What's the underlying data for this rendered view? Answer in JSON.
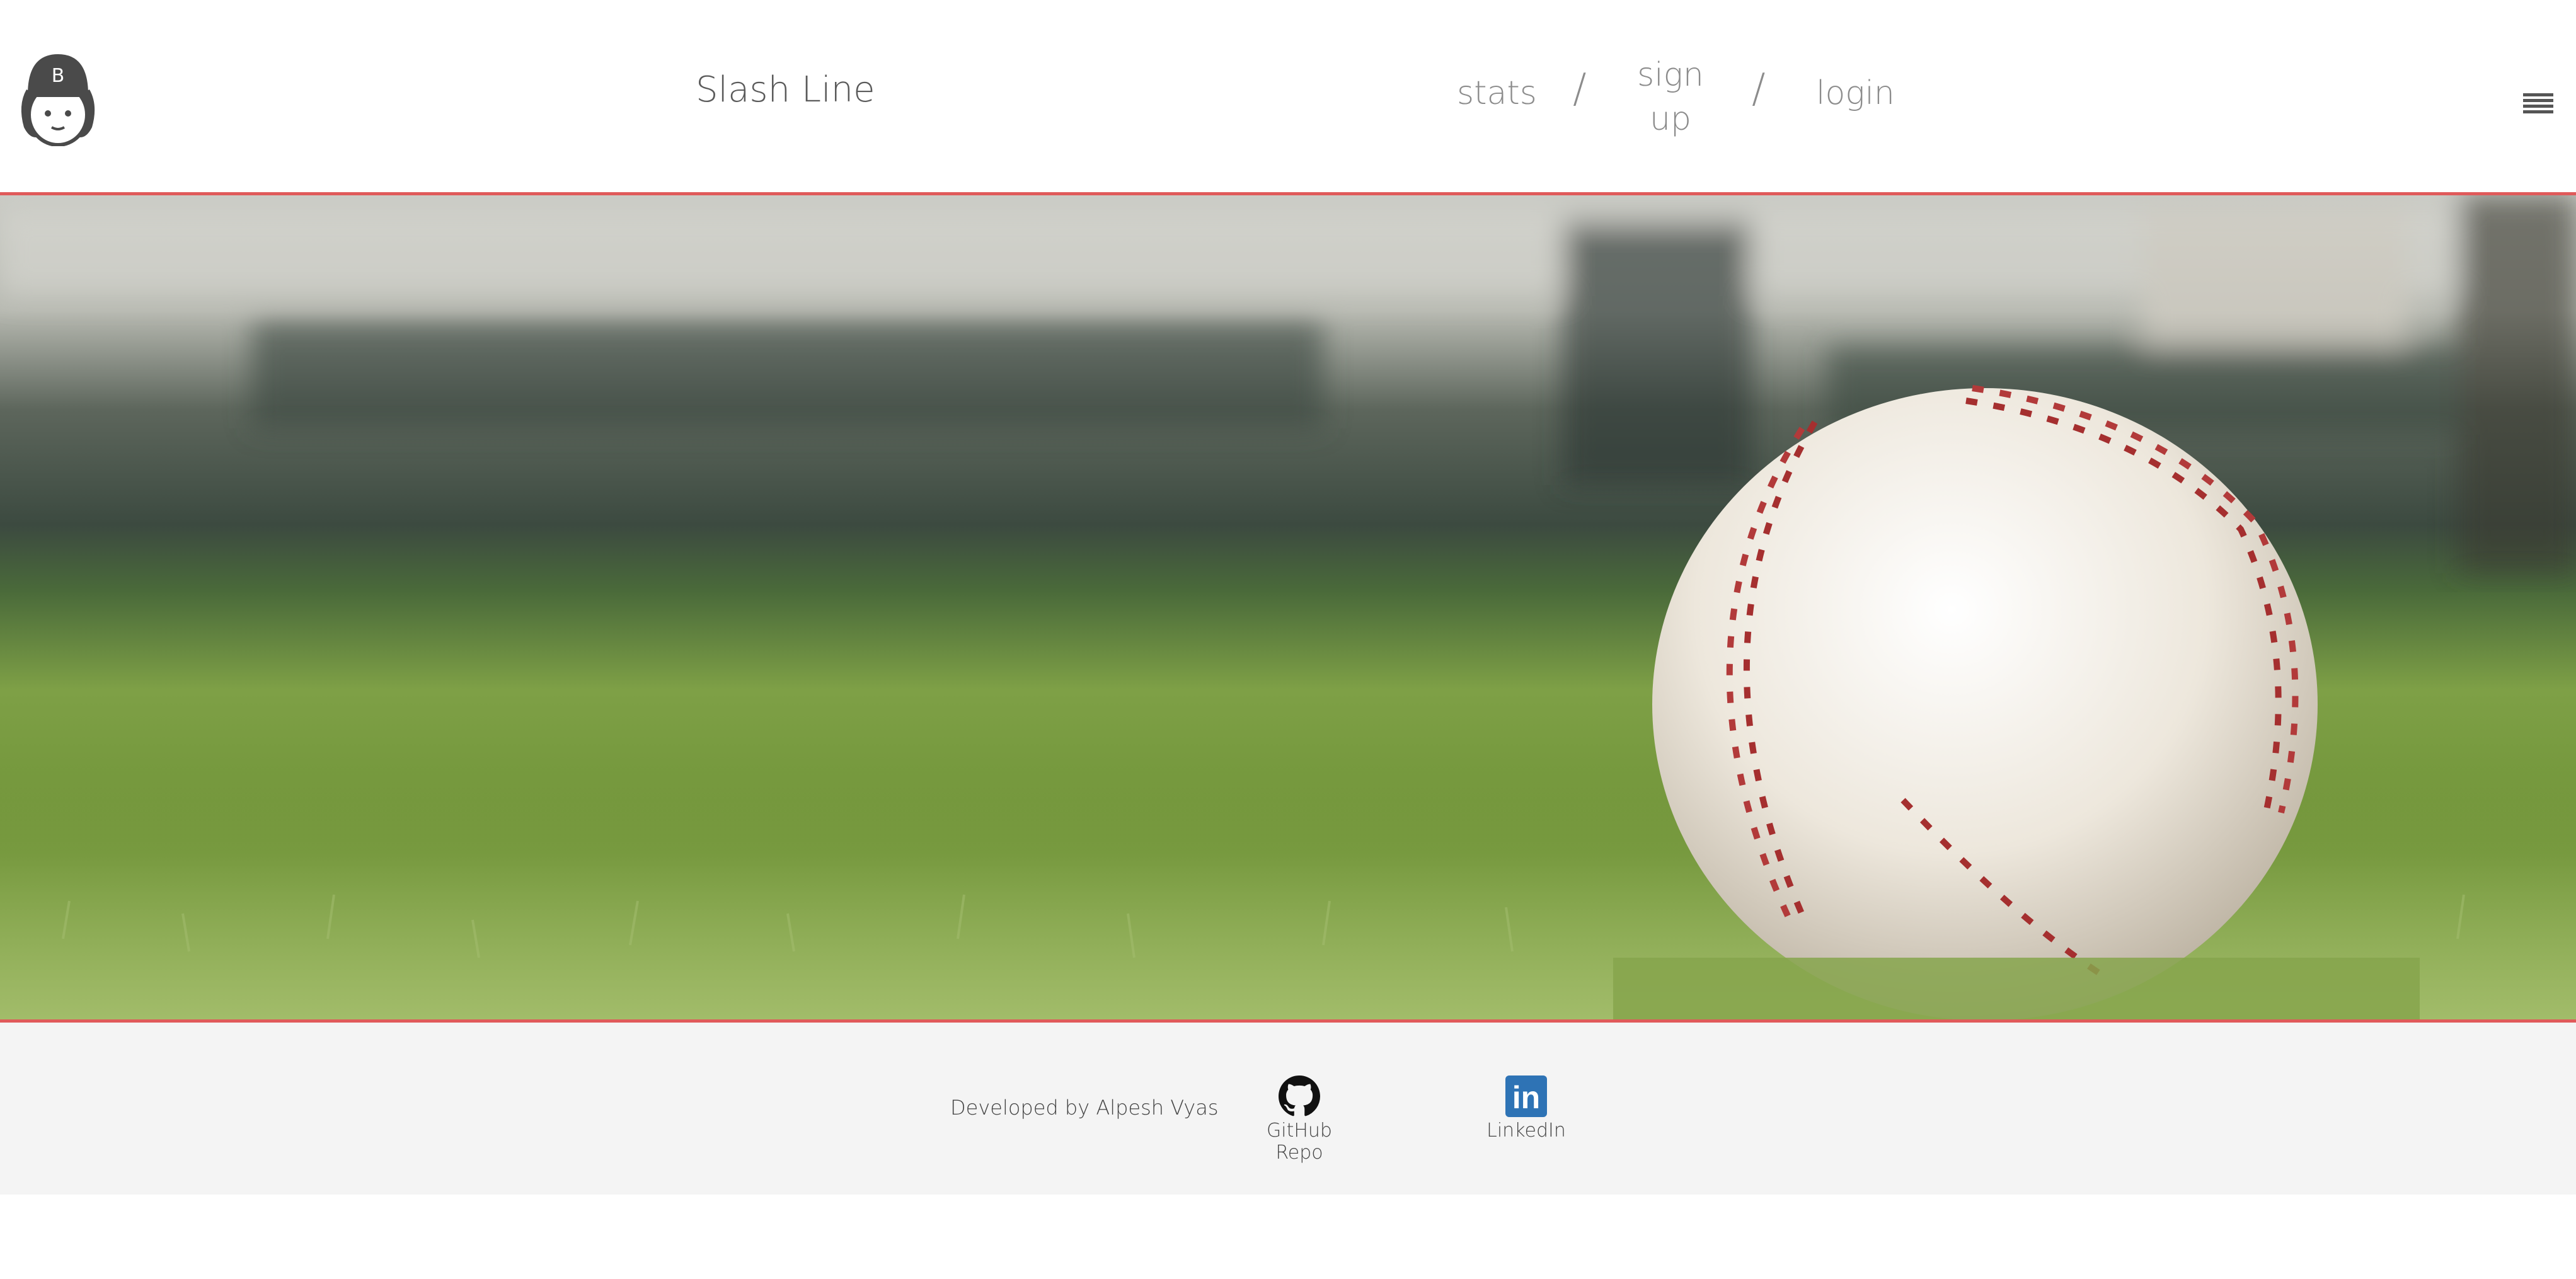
{
  "header": {
    "logo_icon": "baseball-cap-avatar-icon",
    "logo_cap_letter": "B",
    "brand": "Slash Line",
    "nav": {
      "stats": "stats",
      "separator": "/",
      "signup_line1": "sign",
      "signup_line2": "up",
      "login": "login"
    },
    "menu_icon": "hamburger-menu-icon"
  },
  "hero": {
    "image": "baseball-on-grass-photo",
    "border_color": "#e05a5a"
  },
  "footer": {
    "credit": "Developed by Alpesh Vyas",
    "github_label": "GitHub Repo",
    "github_icon": "github-icon",
    "linkedin_label": "LinkedIn",
    "linkedin_icon": "linkedin-icon",
    "linkedin_icon_text": "in",
    "linkedin_color": "#2e73b5"
  }
}
